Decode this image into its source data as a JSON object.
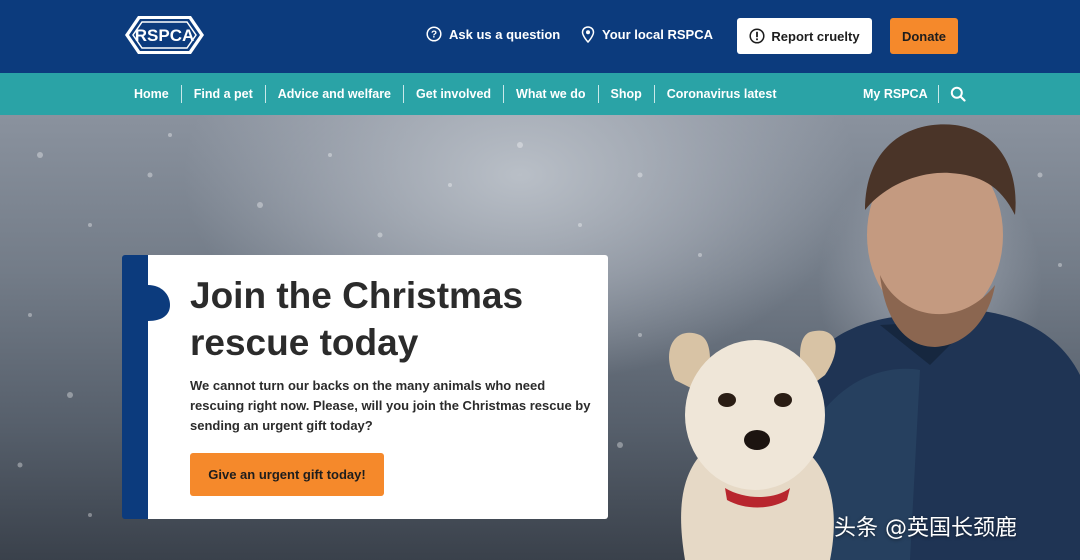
{
  "header": {
    "logo_text": "RSPCA",
    "ask_label": "Ask us a question",
    "local_label": "Your local RSPCA",
    "report_label": "Report cruelty",
    "donate_label": "Donate"
  },
  "nav": {
    "items": [
      {
        "label": "Home"
      },
      {
        "label": "Find a pet"
      },
      {
        "label": "Advice and welfare"
      },
      {
        "label": "Get involved"
      },
      {
        "label": "What we do"
      },
      {
        "label": "Shop"
      },
      {
        "label": "Coronavirus latest"
      }
    ],
    "my_rspca_label": "My RSPCA"
  },
  "hero": {
    "title": "Join the Christmas rescue today",
    "body": "We cannot turn our backs on the many animals who need rescuing right now. Please, will you join the Christmas rescue by sending an urgent gift today?",
    "cta_label": "Give an urgent gift today!"
  },
  "watermark": "头条 @英国长颈鹿",
  "colors": {
    "header_blue": "#0c3b7d",
    "nav_teal": "#2aa3a6",
    "accent_orange": "#f5892b"
  }
}
